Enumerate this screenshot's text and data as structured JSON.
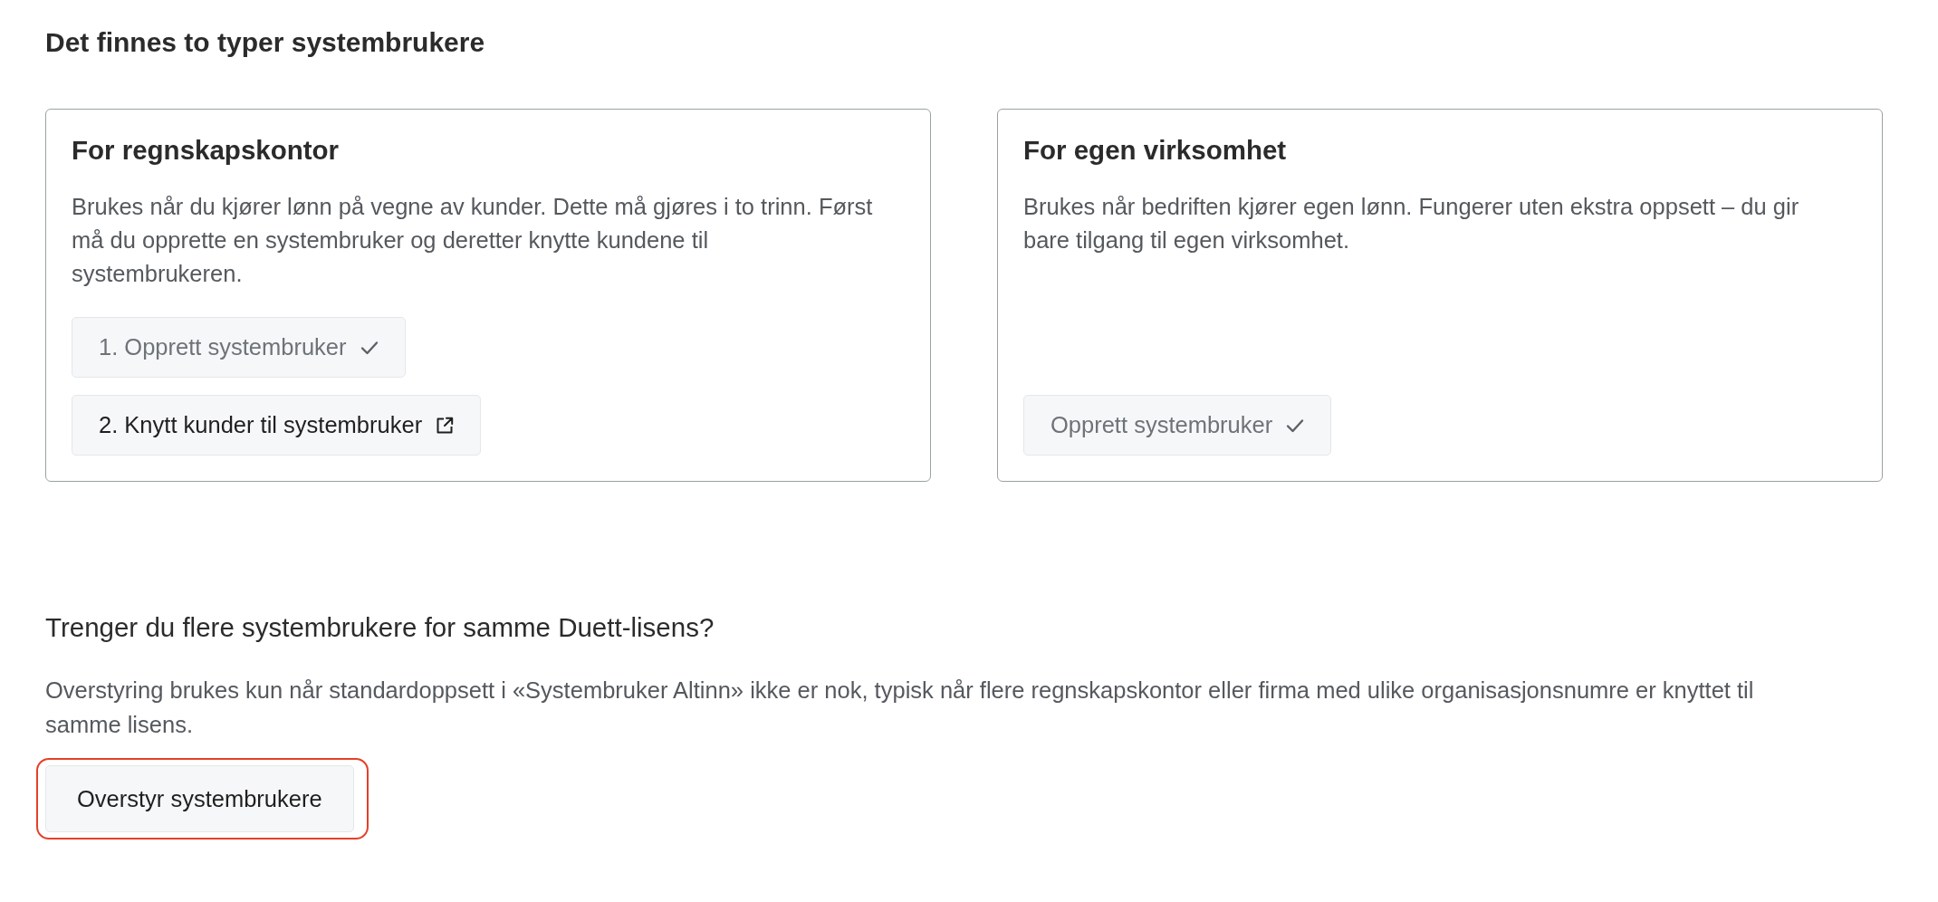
{
  "page": {
    "title": "Det finnes to typer systembrukere"
  },
  "cards": [
    {
      "title": "For regnskapskontor",
      "description": "Brukes når du kjører lønn på vegne av kunder. Dette må gjøres i to trinn. Først må du opprette en systembruker og deretter knytte kundene til systembrukeren.",
      "actions": [
        {
          "label": "1. Opprett systembruker",
          "completed": true
        },
        {
          "label": "2. Knytt kunder til systembruker",
          "completed": false
        }
      ]
    },
    {
      "title": "For egen virksomhet",
      "description": "Brukes når bedriften kjører egen lønn. Fungerer uten ekstra oppsett – du gir bare tilgang til egen virksomhet.",
      "actions": [
        {
          "label": "Opprett systembruker",
          "completed": true
        }
      ]
    }
  ],
  "override": {
    "heading": "Trenger du flere systembrukere for samme Duett-lisens?",
    "description": "Overstyring brukes kun når standardoppsett i «Systembruker Altinn» ikke er nok, typisk når flere regnskapskontor eller firma med ulike organisasjonsnumre er knyttet til samme lisens.",
    "button": {
      "label": "Overstyr systembrukere",
      "highlighted": true
    }
  }
}
